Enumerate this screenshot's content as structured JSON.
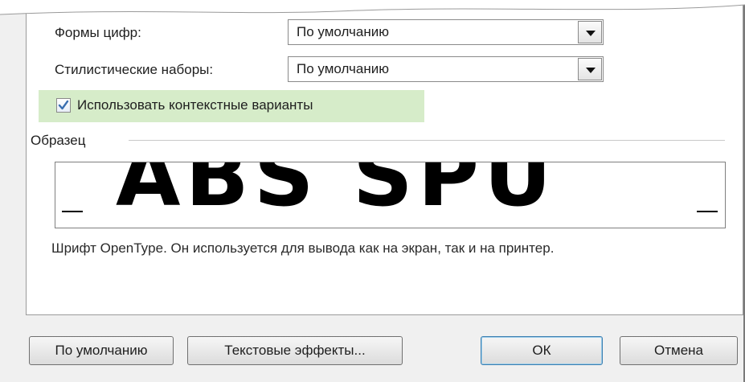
{
  "options": {
    "digit_forms_label": "Формы цифр:",
    "digit_forms_value": "По умолчанию",
    "stylistic_sets_label": "Стилистические наборы:",
    "stylistic_sets_value": "По умолчанию",
    "contextual_alternates_label": "Использовать контекстные варианты",
    "contextual_alternates_checked": true
  },
  "sample": {
    "group_label": "Образец",
    "preview_text": "ABS SPU",
    "description": "Шрифт OpenType. Он используется для вывода как на экран, так и на принтер."
  },
  "buttons": {
    "default_label": "По умолчанию",
    "text_effects_label": "Текстовые эффекты...",
    "ok_label": "ОК",
    "cancel_label": "Отмена"
  },
  "colors": {
    "highlight": "#d6ecc9",
    "ok_border": "#3c7fb1"
  }
}
